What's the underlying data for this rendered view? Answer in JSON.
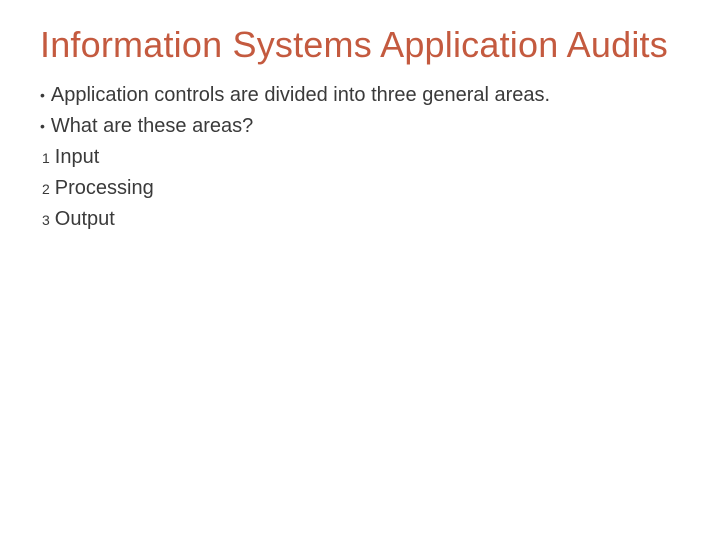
{
  "title": "Information Systems  Application Audits",
  "bullets": [
    "Application controls are divided into three general areas.",
    "What are these areas?"
  ],
  "numbered": [
    {
      "n": "1",
      "text": "Input"
    },
    {
      "n": "2",
      "text": "Processing"
    },
    {
      "n": "3",
      "text": "Output"
    }
  ]
}
